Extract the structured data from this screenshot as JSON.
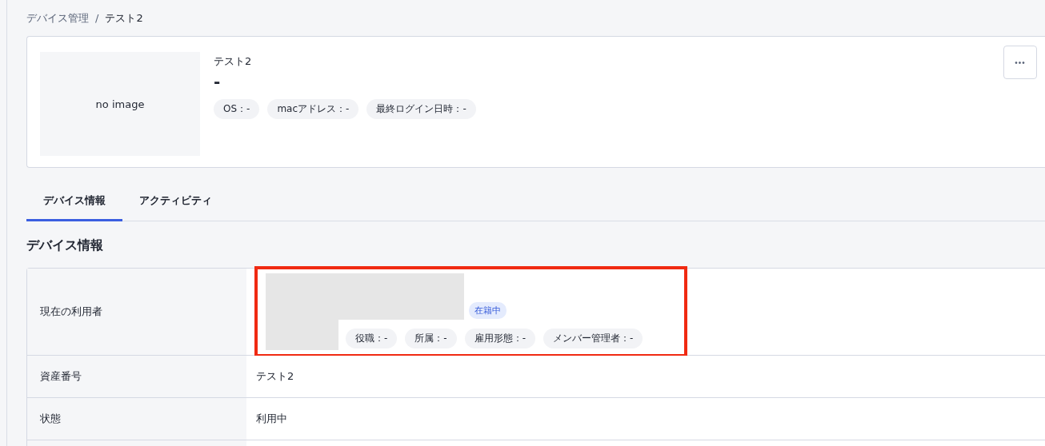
{
  "breadcrumb": [
    {
      "label": "デバイス管理",
      "link": true
    },
    {
      "label": "テスト2",
      "link": false
    }
  ],
  "breadcrumb_separator": "/",
  "device": {
    "image_placeholder": "no image",
    "name": "テスト2",
    "subtitle": "-",
    "chips": [
      "OS：-",
      "macアドレス：-",
      "最終ログイン日時：-"
    ]
  },
  "more_button": "•••",
  "tabs": [
    {
      "label": "デバイス情報",
      "selected": true
    },
    {
      "label": "アクティビティ",
      "selected": false
    }
  ],
  "section_title": "デバイス情報",
  "rows": [
    {
      "kind": "user",
      "label": "現在の利用者",
      "highlighted": true,
      "status": "在籍中",
      "chips": [
        "役職：-",
        "所属：-",
        "雇用形態：-",
        "メンバー管理者：-"
      ]
    },
    {
      "kind": "text",
      "label": "資産番号",
      "value": "テスト2"
    },
    {
      "kind": "text",
      "label": "状態",
      "value": "利用中"
    },
    {
      "kind": "empty"
    }
  ]
}
